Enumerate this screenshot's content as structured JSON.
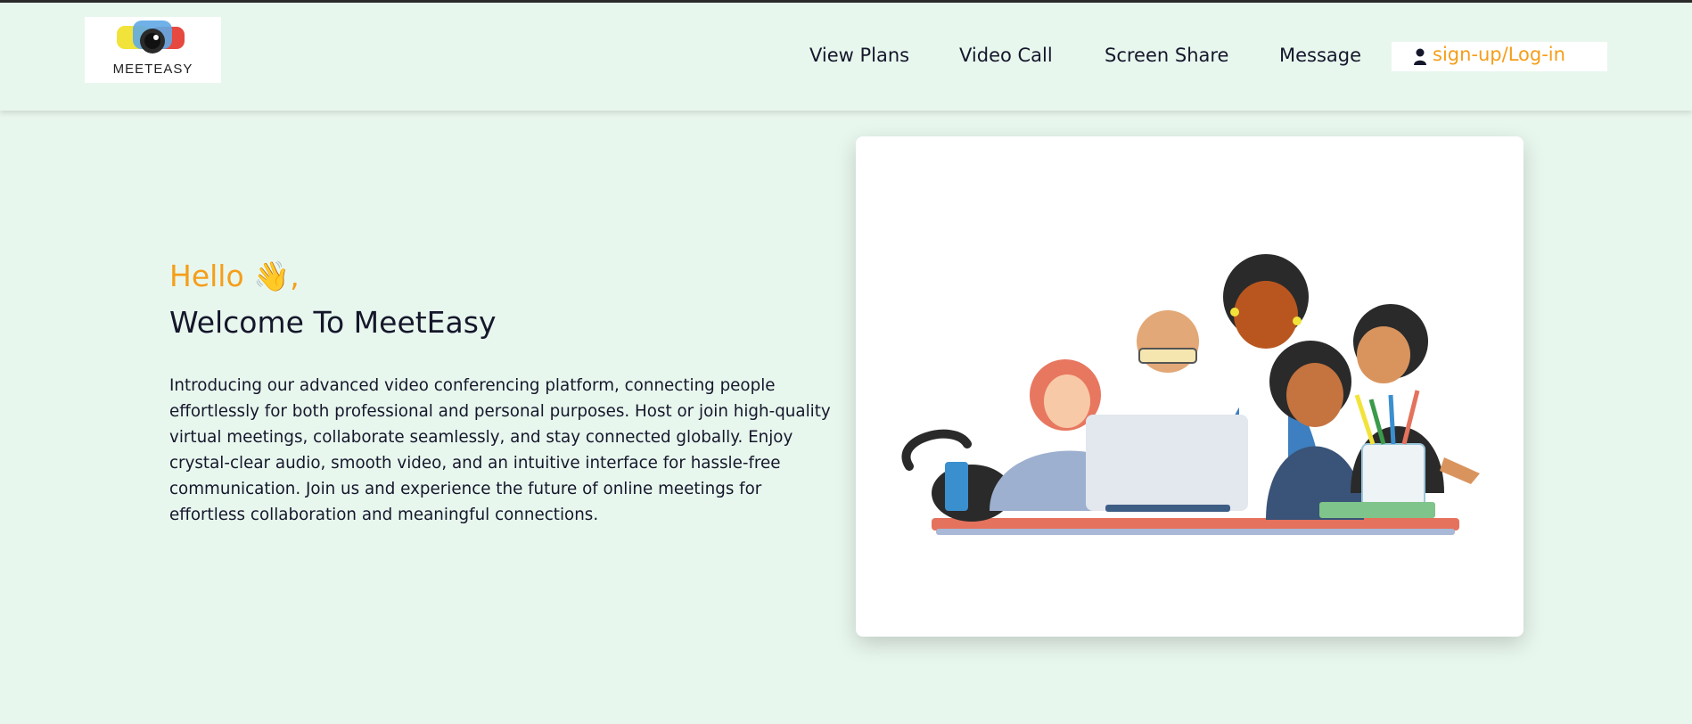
{
  "brand": {
    "logo_text": "MEETEASY"
  },
  "nav": {
    "items": [
      {
        "label": "View Plans"
      },
      {
        "label": "Video Call"
      },
      {
        "label": "Screen Share"
      },
      {
        "label": "Message"
      }
    ],
    "login_label": "sign-up/Log-in",
    "login_icon": "user-icon"
  },
  "hero": {
    "greeting": "Hello 👋,",
    "title": "Welcome To MeetEasy",
    "description": "Introducing our advanced video conferencing platform, connecting people effortlessly for both professional and personal purposes. Host or join high-quality virtual meetings, collaborate seamlessly, and stay connected globally. Enjoy crystal-clear audio, smooth video, and an intuitive interface for hassle-free communication. Join us and experience the future of online meetings for effortless collaboration and meaningful connections."
  },
  "colors": {
    "accent": "#f59e1a",
    "background": "#e8f7ee",
    "text": "#15172b"
  }
}
